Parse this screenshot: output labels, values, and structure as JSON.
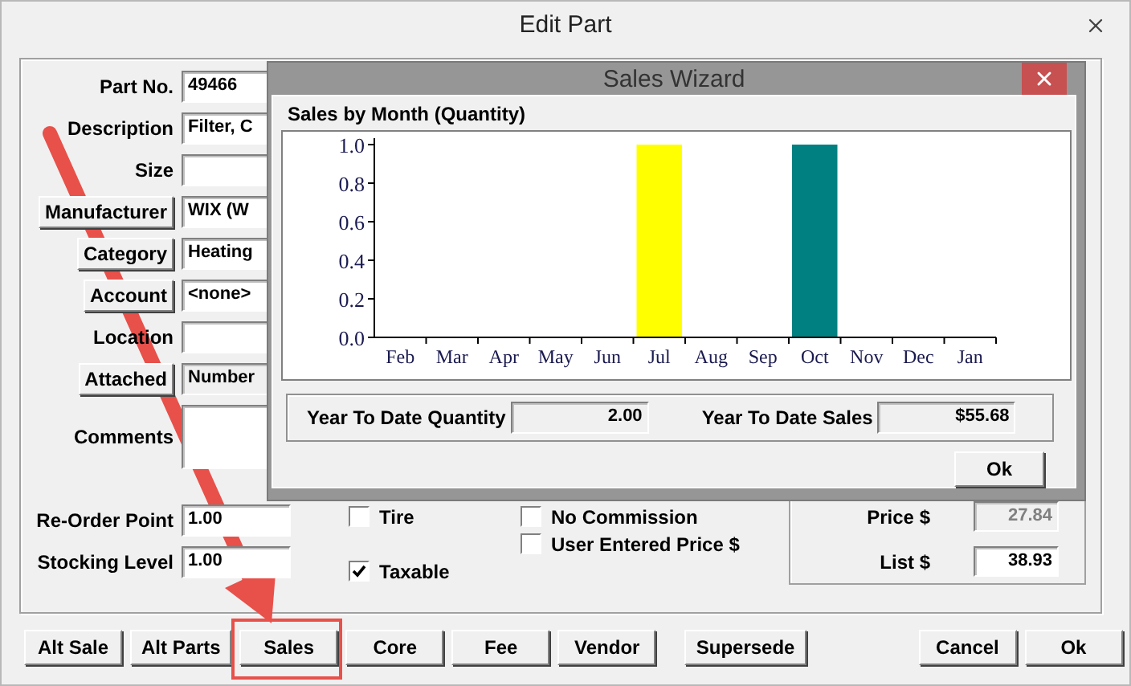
{
  "window": {
    "title": "Edit Part"
  },
  "fields": [
    {
      "kind": "text",
      "label": "Part No.",
      "value": "49466",
      "disabled": false
    },
    {
      "kind": "text",
      "label": "Description",
      "value": "Filter, C",
      "disabled": false
    },
    {
      "kind": "text",
      "label": "Size",
      "disabled": false
    },
    {
      "kind": "button",
      "label": "Manufacturer",
      "value": "WIX (W",
      "disabled": false
    },
    {
      "kind": "button",
      "label": "Category",
      "value": "Heating",
      "disabled": false
    },
    {
      "kind": "button",
      "label": "Account",
      "value": "<none>",
      "disabled": false
    },
    {
      "kind": "text",
      "label": "Location",
      "disabled": false
    },
    {
      "kind": "button",
      "label": "Attached",
      "value": "Number",
      "disabled": true
    },
    {
      "kind": "multiline",
      "label": "Comments",
      "disabled": false
    },
    {
      "kind": "text",
      "label": "Re-Order Point",
      "value": "1.00",
      "disabled": false
    },
    {
      "kind": "text",
      "label": "Stocking Level",
      "value": "1.00",
      "disabled": false
    }
  ],
  "options": [
    {
      "label": "Tire",
      "checked": false
    },
    {
      "label": "No Commission",
      "checked": false
    },
    {
      "label": "User Entered Price $",
      "checked": false
    },
    {
      "label": "Taxable",
      "checked": true
    }
  ],
  "pricing": [
    {
      "label": "Price $",
      "value": "27.84",
      "disabled": true
    },
    {
      "label": "List $",
      "value": "38.93",
      "disabled": false
    }
  ],
  "buttons_left": [
    "Alt Sale",
    "Alt Parts",
    "Sales",
    "Core",
    "Fee",
    "Vendor",
    "Supersede"
  ],
  "buttons_right": [
    "Cancel",
    "Ok"
  ],
  "sales_wizard": {
    "title": "Sales Wizard",
    "chart_title": "Sales by Month (Quantity)",
    "chart_data": {
      "type": "bar",
      "categories": [
        "Feb",
        "Mar",
        "Apr",
        "May",
        "Jun",
        "Jul",
        "Aug",
        "Sep",
        "Oct",
        "Nov",
        "Dec",
        "Jan"
      ],
      "stacked": true,
      "ylim": [
        0,
        1
      ],
      "yticks": [
        {
          "value": 0,
          "label": "0.0"
        },
        {
          "value": 0.2,
          "label": "0.2"
        },
        {
          "value": 0.4,
          "label": "0.4"
        },
        {
          "value": 0.6,
          "label": "0.6"
        },
        {
          "value": 0.8,
          "label": "0.8"
        },
        {
          "value": 1,
          "label": "1.0"
        }
      ],
      "series": [
        {
          "color": "#ffff00",
          "values": [
            0,
            0,
            0,
            0,
            0,
            1,
            0,
            0,
            0,
            0,
            0,
            0
          ]
        },
        {
          "color": "#008080",
          "values": [
            0,
            0,
            0,
            0,
            0,
            0,
            0,
            0,
            1,
            0,
            0,
            0
          ]
        }
      ]
    },
    "summary": [
      {
        "label": "Year To Date Quantity",
        "value": "2.00"
      },
      {
        "label": "Year To Date Sales",
        "value": "$55.68"
      }
    ],
    "ok_button": "Ok"
  }
}
